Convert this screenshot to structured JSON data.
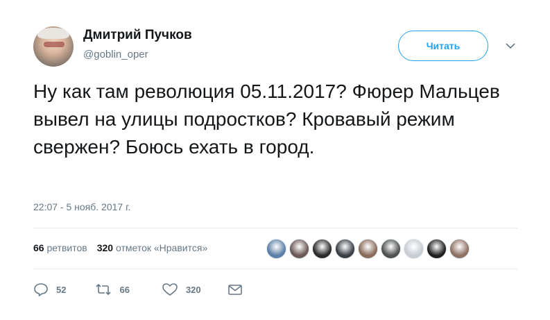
{
  "user": {
    "display_name": "Дмитрий Пучков",
    "handle": "@goblin_oper"
  },
  "follow_button": {
    "label": "Читать"
  },
  "tweet": {
    "text": "Ну как там революция 05.11.2017? Фюрер Мальцев вывел на улицы подростков? Кровавый режим свержен? Боюсь ехать в город.",
    "timestamp": "22:07 - 5 нояб. 2017 г."
  },
  "stats": {
    "retweets_count": "66",
    "retweets_label": "ретвитов",
    "likes_count": "320",
    "likes_label": "отметок «Нравится»"
  },
  "likers": [
    {
      "color": "#5b7fa6",
      "icon": "avatar"
    },
    {
      "color": "#6b5a55",
      "icon": "avatar"
    },
    {
      "color": "#2b2b2b",
      "icon": "avatar"
    },
    {
      "color": "#3a3f47",
      "icon": "avatar"
    },
    {
      "color": "#8a6b5a",
      "icon": "avatar"
    },
    {
      "color": "#4f524f",
      "icon": "avatar"
    },
    {
      "color": "#c7cdd3",
      "icon": "avatar"
    },
    {
      "color": "#1f1f1f",
      "icon": "avatar"
    },
    {
      "color": "#8f7064",
      "icon": "avatar"
    }
  ],
  "actions": {
    "reply_count": "52",
    "retweet_count": "66",
    "like_count": "320"
  },
  "icons": {
    "reply": "reply-icon",
    "retweet": "retweet-icon",
    "like": "heart-icon",
    "message": "envelope-icon",
    "more": "chevron-down-icon"
  },
  "colors": {
    "accent": "#1da1f2",
    "text": "#14171a",
    "muted": "#657786"
  }
}
